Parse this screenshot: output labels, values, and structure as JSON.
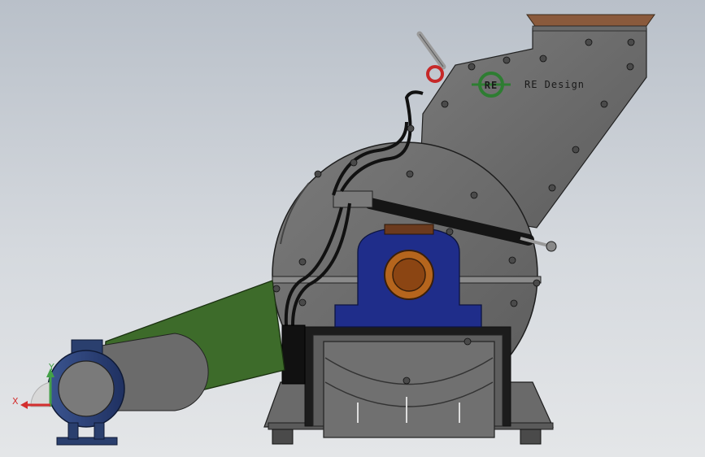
{
  "brand": {
    "logo_letters": "RE",
    "logo_text": "RE Design"
  },
  "triad": {
    "x_label": "X",
    "y_label": "Y"
  },
  "colors": {
    "background_top": "#b9c0c9",
    "housing": "#6b6b6b",
    "bearing_block": "#1f2d8a",
    "belt_guard": "#3d6b2a",
    "hopper_lip": "#8a5a3c",
    "motor": "#2a3f6e",
    "logo": "#2e7d32",
    "axis_x": "#d32f2f",
    "axis_y": "#43a047"
  }
}
